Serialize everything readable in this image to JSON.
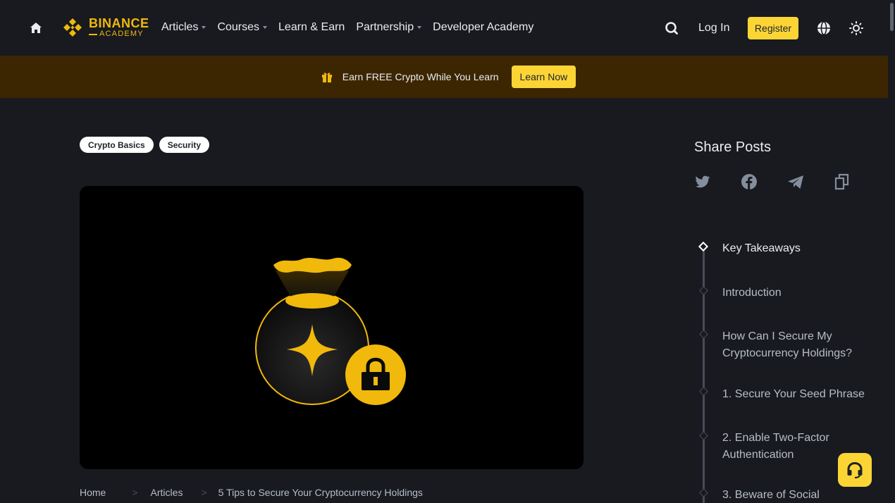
{
  "header": {
    "logo": {
      "top": "BINANCE",
      "bottom": "ACADEMY"
    },
    "nav": [
      {
        "label": "Articles",
        "has_caret": true
      },
      {
        "label": "Courses",
        "has_caret": true
      },
      {
        "label": "Learn & Earn",
        "has_caret": false
      },
      {
        "label": "Partnership",
        "has_caret": true
      },
      {
        "label": "Developer Academy",
        "has_caret": false
      }
    ],
    "login_label": "Log In",
    "register_label": "Register",
    "icons": {
      "home": "home-icon",
      "search": "search-icon",
      "language": "globe-icon",
      "theme": "sun-icon"
    }
  },
  "promo": {
    "text": "Earn FREE Crypto While You Learn",
    "button_label": "Learn Now",
    "icon": "gift-icon"
  },
  "article": {
    "tags": [
      "Crypto Basics",
      "Security"
    ],
    "breadcrumb": {
      "home": "Home",
      "articles": "Articles",
      "current": "5 Tips to Secure Your Cryptocurrency Holdings"
    }
  },
  "sidebar": {
    "share_title": "Share Posts",
    "share_icons": [
      "twitter-icon",
      "facebook-icon",
      "telegram-icon",
      "copy-link-icon"
    ],
    "toc": [
      {
        "label": "Key Takeaways",
        "active": true
      },
      {
        "label": "Introduction",
        "active": false
      },
      {
        "label": "How Can I Secure My Cryptocurrency Holdings?",
        "active": false
      },
      {
        "label": "1. Secure Your Seed Phrase",
        "active": false
      },
      {
        "label": "2. Enable Two-Factor Authentication",
        "active": false
      },
      {
        "label": "3. Beware of Social",
        "active": false
      }
    ]
  },
  "colors": {
    "background": "#181a20",
    "brand_yellow": "#fcd535",
    "logo_yellow": "#f0b90b",
    "promo_background": "#3c2601",
    "text_primary": "#eaecef",
    "text_secondary": "#b7bdc6"
  }
}
